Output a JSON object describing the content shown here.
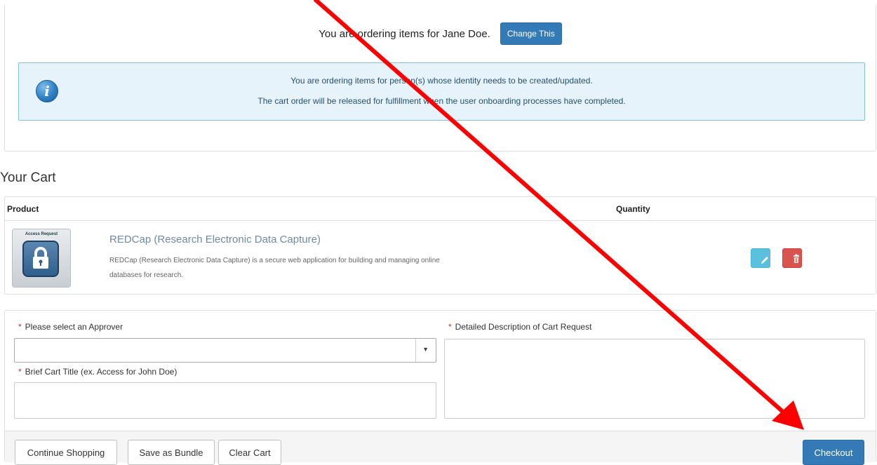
{
  "ordering": {
    "text": "You are ordering items for Jane Doe.",
    "change_button": "Change This"
  },
  "info_alert": {
    "icon": "info-icon",
    "icon_glyph": "i",
    "line1": "You are ordering items for person(s) whose identity needs to be created/updated.",
    "line2": "The cart order will be released for fulfillment when the user onboarding processes have completed."
  },
  "cart": {
    "title": "Your Cart",
    "columns": {
      "product": "Product",
      "quantity": "Quantity"
    },
    "items": [
      {
        "image_label": "Access Request",
        "name": "REDCap (Research Electronic Data Capture)",
        "description_line1": "REDCap (Research Electronic Data Capture) is a secure web application for building and managing online",
        "description_line2": "databases for research.",
        "actions": [
          "edit-icon",
          "trash-icon"
        ]
      }
    ]
  },
  "form": {
    "required_marker": "*",
    "approver_label": "Please select an Approver",
    "approver_value": "",
    "title_label": "Brief Cart Title (ex. Access for John Doe)",
    "title_value": "",
    "description_label": "Detailed Description of Cart Request",
    "description_value": ""
  },
  "footer": {
    "continue_shopping": "Continue Shopping",
    "save_bundle": "Save as Bundle",
    "clear_cart": "Clear Cart",
    "checkout": "Checkout"
  },
  "colors": {
    "primary": "#337ab7",
    "info_bg": "#e6f3fa",
    "edit": "#5bc0de",
    "delete": "#d9534f",
    "annotation_arrow": "#ff0000"
  }
}
